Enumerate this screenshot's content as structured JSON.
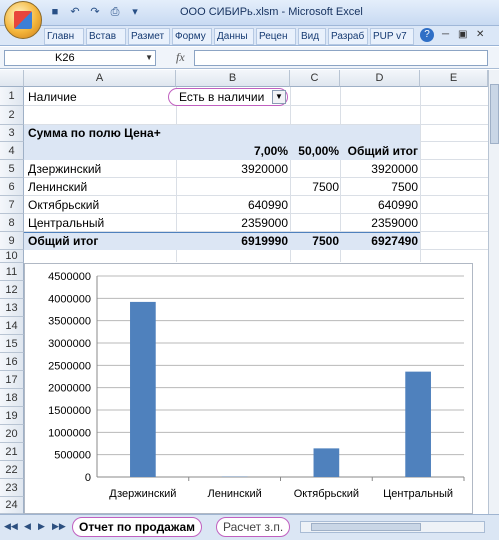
{
  "window": {
    "title": "ООО СИБИРь.xlsm - Microsoft Excel"
  },
  "ribbon": {
    "tabs": [
      "Главн",
      "Встав",
      "Размет",
      "Форму",
      "Данны",
      "Рецен",
      "Вид",
      "Разраб",
      "PUP v7"
    ],
    "help": "?"
  },
  "formula_bar": {
    "name_box": "K26",
    "fx": "fx",
    "formula": ""
  },
  "columns": [
    "A",
    "B",
    "C",
    "D",
    "E"
  ],
  "rows": [
    "1",
    "2",
    "3",
    "4",
    "5",
    "6",
    "7",
    "8",
    "9",
    "10",
    "11",
    "12",
    "13",
    "14",
    "15",
    "16",
    "17",
    "18",
    "19",
    "20",
    "21",
    "22",
    "23",
    "24"
  ],
  "pivot": {
    "filter_label": "Наличие",
    "filter_value": "Есть в наличии",
    "title": "Сумма по полю Цена+",
    "col_headers": [
      "7,00%",
      "50,00%",
      "Общий итог"
    ],
    "rows": [
      {
        "label": "Дзержинский",
        "v1": "3920000",
        "v2": "",
        "total": "3920000"
      },
      {
        "label": "Ленинский",
        "v1": "",
        "v2": "7500",
        "total": "7500"
      },
      {
        "label": "Октябрьский",
        "v1": "640990",
        "v2": "",
        "total": "640990"
      },
      {
        "label": "Центральный",
        "v1": "2359000",
        "v2": "",
        "total": "2359000"
      }
    ],
    "grand_total": {
      "label": "Общий итог",
      "v1": "6919990",
      "v2": "7500",
      "total": "6927490"
    }
  },
  "chart_data": {
    "type": "bar",
    "categories": [
      "Дзержинский",
      "Ленинский",
      "Октябрьский",
      "Центральный"
    ],
    "values": [
      3920000,
      7500,
      640990,
      2359000
    ],
    "title": "",
    "xlabel": "",
    "ylabel": "",
    "ylim": [
      0,
      4500000
    ],
    "yticks": [
      "0",
      "500000",
      "1000000",
      "1500000",
      "2000000",
      "2500000",
      "3000000",
      "3500000",
      "4000000",
      "4500000"
    ],
    "bar_color": "#4f81bd",
    "grid": true
  },
  "sheets": [
    "Отчет по продажам",
    "Расчет з.п."
  ],
  "active_sheet": 0
}
